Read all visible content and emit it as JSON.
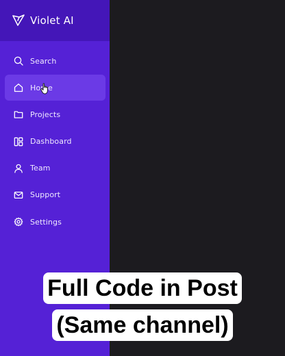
{
  "brand": {
    "name": "Violet AI",
    "icon": "violet-logo-icon"
  },
  "nav": {
    "items": [
      {
        "label": "Search",
        "icon": "search-icon"
      },
      {
        "label": "Home",
        "icon": "home-icon",
        "active": true
      },
      {
        "label": "Projects",
        "icon": "folder-icon"
      },
      {
        "label": "Dashboard",
        "icon": "dashboard-icon"
      },
      {
        "label": "Team",
        "icon": "user-icon"
      },
      {
        "label": "Support",
        "icon": "mail-icon"
      },
      {
        "label": "Settings",
        "icon": "gear-icon"
      }
    ]
  },
  "overlay": {
    "line1": "Full Code in Post",
    "line2": "(Same channel)"
  },
  "colors": {
    "sidebar": "#5521d6",
    "brand_bar": "#4416b8",
    "active_item": "#6b3ae6",
    "main_bg": "#1c1b1f"
  }
}
